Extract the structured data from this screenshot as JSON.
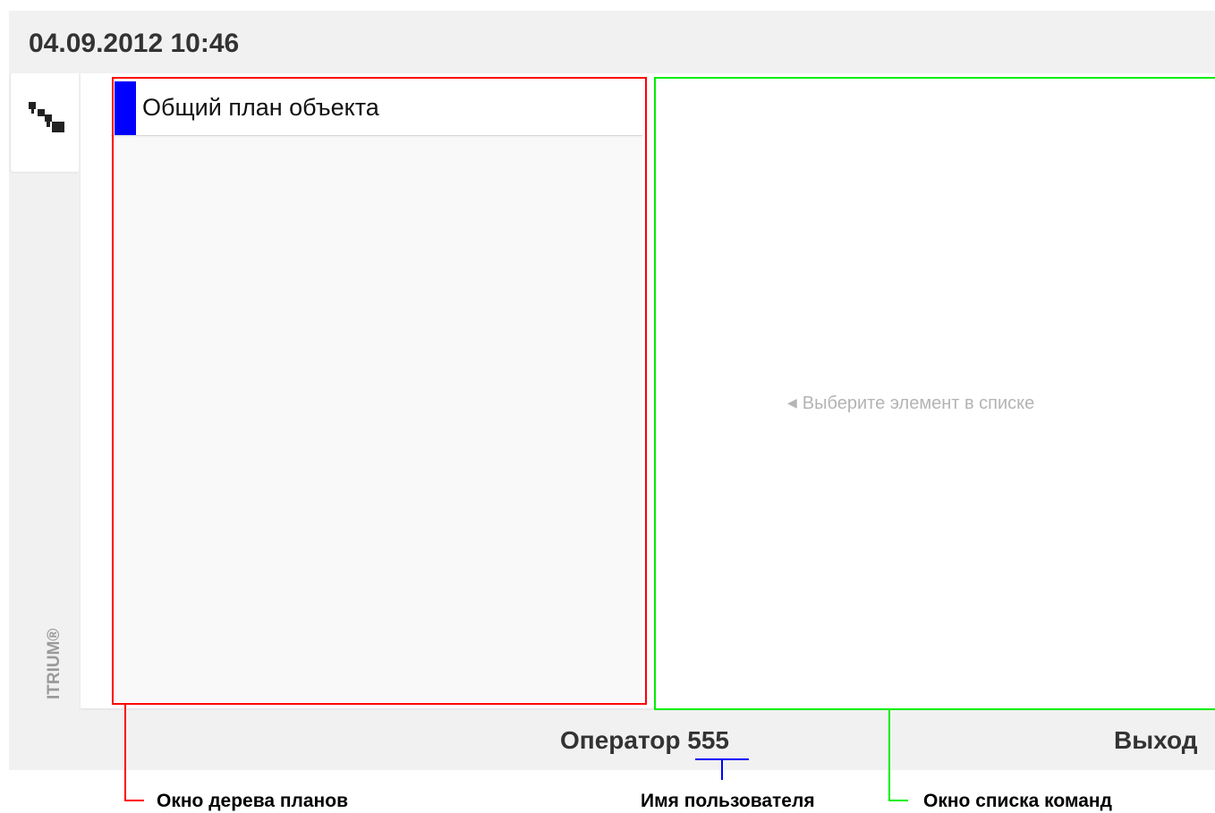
{
  "header": {
    "datetime": "04.09.2012 10:46"
  },
  "sidebar": {
    "tab_icon": "tree-icon",
    "brand": "ITRIUM®"
  },
  "tree": {
    "items": [
      {
        "label": "Общий план объекта"
      }
    ]
  },
  "commands": {
    "placeholder": "Выберите элемент в списке",
    "placeholder_icon": "left-triangle-icon"
  },
  "footer": {
    "operator_label": "Оператор",
    "username": "555",
    "logout_label": "Выход"
  },
  "annotations": {
    "tree_window": "Окно дерева планов",
    "username": "Имя пользователя",
    "commands_window": "Окно списка команд"
  },
  "colors": {
    "tree_annotation": "#ff0000",
    "commands_annotation": "#00ee00",
    "username_annotation": "#0000ff",
    "selected_marker": "#0000ff"
  }
}
